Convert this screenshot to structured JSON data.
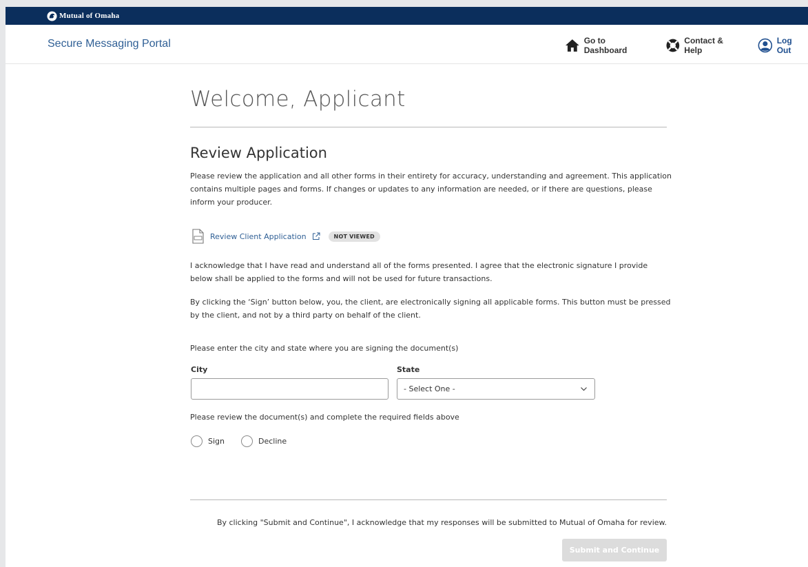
{
  "brand": {
    "logo_text": "Mutual of Omaha"
  },
  "header": {
    "portal_title": "Secure Messaging Portal",
    "nav": {
      "dashboard": "Go to Dashboard",
      "help": "Contact & Help",
      "logout": "Log Out"
    }
  },
  "main": {
    "welcome": "Welcome, Applicant",
    "section_title": "Review Application",
    "intro": "Please review the application and all other forms in their entirety for accuracy, understanding and agreement. This application contains multiple pages and forms. If changes or updates to any information are needed, or if there are questions, please inform your producer.",
    "document": {
      "link_label": "Review Client Application",
      "status_badge": "NOT VIEWED"
    },
    "acknowledge": "I acknowledge that I have read and understand all of the forms presented. I agree that the electronic signature I provide below shall be applied to the forms and will not be used for future transactions.",
    "sign_notice": "By clicking the ‘Sign’ button below, you, the client, are electronically signing all applicable forms. This button must be pressed by the client, and not by a third party on behalf of the client.",
    "location_prompt": "Please enter the city and state where you are signing the document(s)",
    "city": {
      "label": "City",
      "value": ""
    },
    "state": {
      "label": "State",
      "selected": "- Select One -"
    },
    "required_notice": "Please review the document(s) and complete the required fields above",
    "radios": {
      "sign": "Sign",
      "decline": "Decline"
    },
    "submit_ack": "By clicking \"Submit and Continue\", I acknowledge that my responses will be submitted to Mutual of Omaha for review.",
    "submit_label": "Submit and Continue"
  },
  "colors": {
    "top_bar": "#0b2e5c",
    "link": "#2f5f95",
    "button_disabled": "#dcdcdc"
  },
  "icons": [
    "lion-logo-icon",
    "home-icon",
    "help-lifebuoy-icon",
    "user-circle-icon",
    "pdf-document-icon",
    "external-link-icon",
    "chevron-down-icon"
  ]
}
